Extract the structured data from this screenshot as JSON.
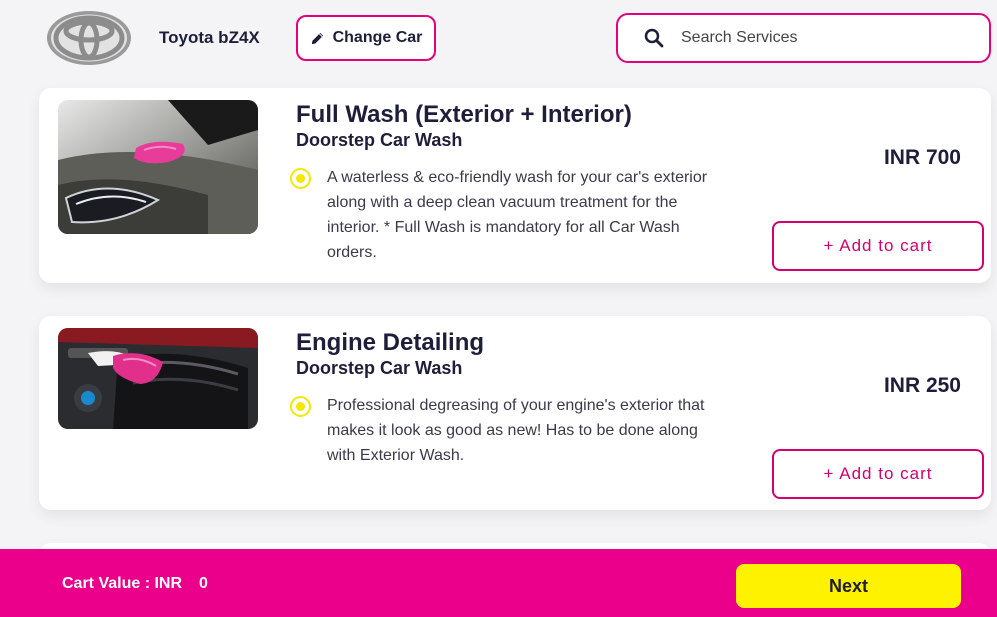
{
  "header": {
    "car_name": "Toyota bZ4X",
    "change_car_label": "Change Car",
    "search_placeholder": "Search Services",
    "logo_icon": "toyota-logo-icon"
  },
  "services": [
    {
      "title": "Full Wash (Exterior + Interior)",
      "subtitle": "Doorstep Car Wash",
      "description": "A waterless & eco-friendly wash for your car's exterior along with a deep clean vacuum treatment for the interior. * Full Wash is mandatory for all Car Wash orders.",
      "price": "INR 700",
      "add_label": "+ Add to cart",
      "image": "car-headlight-wipe-image"
    },
    {
      "title": "Engine Detailing",
      "subtitle": "Doorstep Car Wash",
      "description": "Professional degreasing of your engine's exterior that makes it look as good as new! Has to be done along with Exterior Wash.",
      "price": "INR 250",
      "add_label": "+ Add to cart",
      "image": "engine-cleaning-image"
    }
  ],
  "footer": {
    "cart_label": "Cart Value : INR",
    "cart_value": "0",
    "next_label": "Next"
  },
  "colors": {
    "accent": "#e5007e",
    "footer_bg": "#ea008a",
    "next_bg": "#fff200",
    "bullet": "#f5e800"
  }
}
